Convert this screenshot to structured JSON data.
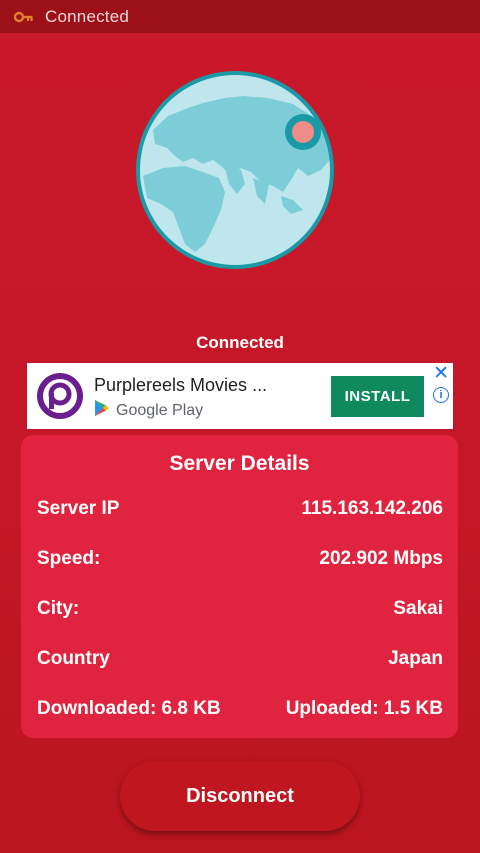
{
  "status_bar": {
    "icon": "key-icon",
    "text": "Connected"
  },
  "connection": {
    "label": "Connected"
  },
  "ad": {
    "title": "Purplereels Movies ...",
    "store_label": "Google Play",
    "install_label": "INSTALL",
    "close_symbol": "✕",
    "info_symbol": "i"
  },
  "server_details": {
    "title": "Server Details",
    "rows": [
      {
        "label": "Server IP",
        "value": "115.163.142.206"
      },
      {
        "label": "Speed:",
        "value": "202.902 Mbps"
      },
      {
        "label": "City:",
        "value": "Sakai"
      },
      {
        "label": "Country",
        "value": "Japan"
      },
      {
        "label": "Downloaded: 6.8 KB",
        "value": "Uploaded: 1.5 KB"
      }
    ]
  },
  "disconnect_label": "Disconnect",
  "colors": {
    "background": "#c41727",
    "status_bar": "#9c1018",
    "panel": "#e0243f",
    "install": "#0f8a5f",
    "globe_ring": "#1a9aa6",
    "globe_ocean": "#bfe6ec",
    "globe_land": "#7ccdd7",
    "location_dot": "#ef8e88"
  }
}
